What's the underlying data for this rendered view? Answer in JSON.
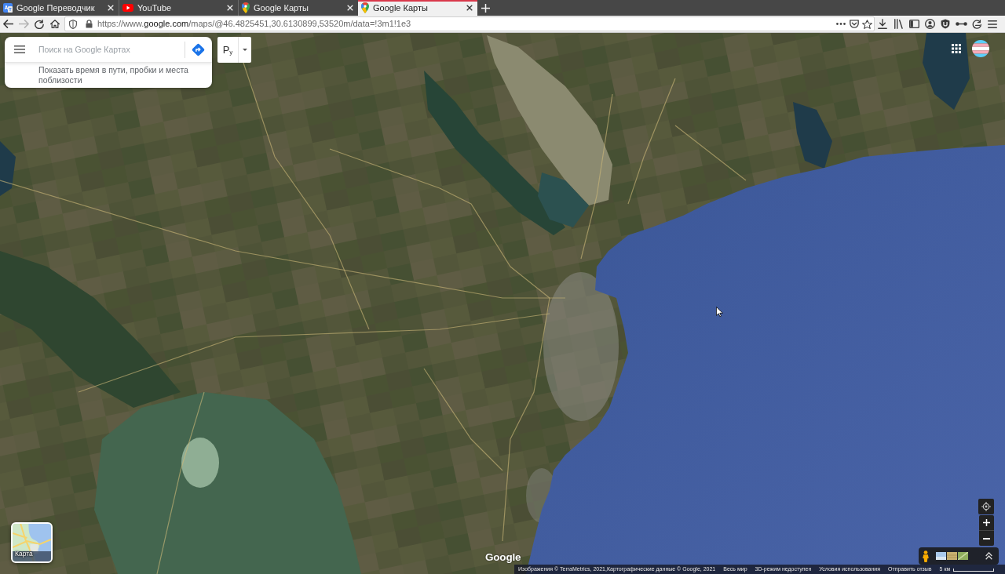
{
  "browser": {
    "tabs": [
      {
        "kind": "translate",
        "title": "Google Переводчик",
        "selected": false
      },
      {
        "kind": "youtube",
        "title": "YouTube",
        "selected": false
      },
      {
        "kind": "maps",
        "title": "Google Карты",
        "selected": false
      },
      {
        "kind": "maps",
        "title": "Google Карты",
        "selected": true
      }
    ],
    "forward_disabled": true,
    "url": {
      "prefix": "https://www.",
      "domain": "google.com",
      "path": "/maps/@46.4825451,30.6130899,53520m/data=!3m1!1e3"
    }
  },
  "maps": {
    "search": {
      "placeholder": "Поиск на Google Картах",
      "hint": "Показать время в пути, пробки и места поблизости"
    },
    "input_tools": {
      "label": "Р$_{у}$"
    },
    "layer_switcher": {
      "label": "Карта"
    },
    "logo": "Google",
    "footer": {
      "attribution": "Изображения © TerraMetrics, 2021,Картографические данные © Google, 2021",
      "links": [
        "Весь мир",
        "3D-режим недоступен",
        "Условия использования",
        "Отправить отзыв"
      ],
      "scale": "5 км"
    }
  }
}
